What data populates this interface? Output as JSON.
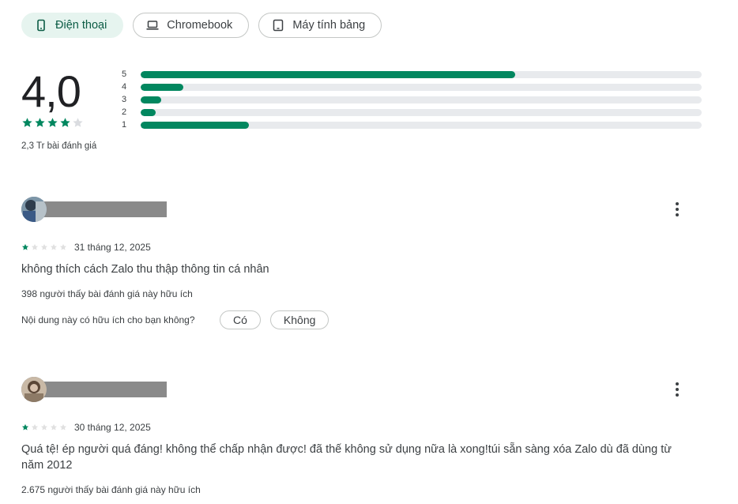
{
  "device_tabs": [
    {
      "label": "Điện thoại",
      "icon": "phone-icon",
      "active": true
    },
    {
      "label": "Chromebook",
      "icon": "laptop-icon",
      "active": false
    },
    {
      "label": "Máy tính bảng",
      "icon": "tablet-icon",
      "active": false
    }
  ],
  "summary": {
    "score": "4,0",
    "stars_filled": 4,
    "total_reviews": "2,3 Tr bài đánh giá",
    "distribution": [
      {
        "label": "5",
        "fraction": 0.667
      },
      {
        "label": "4",
        "fraction": 0.076
      },
      {
        "label": "3",
        "fraction": 0.037
      },
      {
        "label": "2",
        "fraction": 0.027
      },
      {
        "label": "1",
        "fraction": 0.193
      }
    ]
  },
  "reviews": [
    {
      "rating": 1,
      "date": "31 tháng 12, 2025",
      "text": "không thích cách Zalo thu thập thông tin cá nhân",
      "helpful_count": "398 người thấy bài đánh giá này hữu ích",
      "helpful_question": "Nội dung này có hữu ích cho bạn không?",
      "yes_label": "Có",
      "no_label": "Không"
    },
    {
      "rating": 1,
      "date": "30 tháng 12, 2025",
      "text": "Quá tệ! ép người quá đáng! không thể chấp nhận được! đã thế không sử dụng nữa là xong!túi sẵn sàng xóa Zalo dù đã dùng từ năm 2012",
      "helpful_count": "2.675 người thấy bài đánh giá này hữu ích"
    }
  ],
  "colors": {
    "accent": "#01875f",
    "chip_active_bg": "#e6f4ef",
    "track": "#e8eaed"
  }
}
